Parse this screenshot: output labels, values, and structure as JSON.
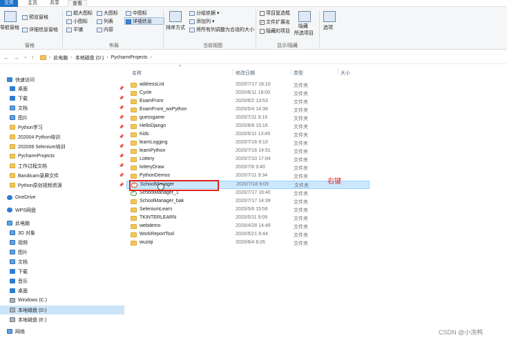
{
  "ribbon": {
    "tabs": [
      "文件",
      "主页",
      "共享",
      "查看"
    ],
    "navpane": {
      "label": "导航窗格"
    },
    "panes": {
      "preview": "预览窗格",
      "details": "详细信息窗格",
      "group": "窗格"
    },
    "layout": {
      "items": [
        "超大图标",
        "大图标",
        "中图标",
        "小图标",
        "列表",
        "详细信息",
        "平铺",
        "内容"
      ],
      "group": "布局"
    },
    "currentview": {
      "sort": "排序方式",
      "group_by": "分组依据",
      "add_columns": "添加列",
      "size_all": "将所有列调整为合适的大小",
      "group": "当前视图"
    },
    "showhide": {
      "item_checkboxes": "项目复选框",
      "file_extensions": "文件扩展名",
      "hidden_items": "隐藏的项目",
      "hide_selected": "隐藏",
      "hide_selected_2": "所选项目",
      "group": "显示/隐藏"
    },
    "options": "选项"
  },
  "address": {
    "crumbs": [
      "此电脑",
      "本地磁盘 (D:)",
      "PycharmProjects"
    ]
  },
  "sidebar": {
    "items": [
      {
        "label": "快速访问",
        "icon": "star-icon"
      },
      {
        "label": "桌面",
        "icon": "desktop-icon",
        "pinned": true
      },
      {
        "label": "下载",
        "icon": "download-icon",
        "pinned": true
      },
      {
        "label": "文档",
        "icon": "documents-icon",
        "pinned": true
      },
      {
        "label": "图片",
        "icon": "pictures-icon",
        "pinned": true
      },
      {
        "label": "Python学习",
        "icon": "folder-icon",
        "pinned": true
      },
      {
        "label": "202004 Python培训",
        "icon": "folder-icon",
        "pinned": true
      },
      {
        "label": "202006 Selenium培训",
        "icon": "folder-icon",
        "pinned": true
      },
      {
        "label": "PycharmProjects",
        "icon": "folder-icon",
        "pinned": true
      },
      {
        "label": "工作过程文档",
        "icon": "folder-icon",
        "pinned": true
      },
      {
        "label": "Bandicam录屏文件",
        "icon": "folder-icon",
        "pinned": true
      },
      {
        "label": "Python原创视频资源",
        "icon": "folder-icon",
        "pinned": true
      },
      {
        "label": "OneDrive",
        "icon": "onedrive-icon"
      },
      {
        "label": "WPS网盘",
        "icon": "wps-cloud-icon"
      },
      {
        "label": "此电脑",
        "icon": "this-pc-icon"
      },
      {
        "label": "3D 对象",
        "icon": "3d-objects-icon"
      },
      {
        "label": "视频",
        "icon": "videos-icon"
      },
      {
        "label": "图片",
        "icon": "pictures-icon"
      },
      {
        "label": "文档",
        "icon": "documents-icon"
      },
      {
        "label": "下载",
        "icon": "download-icon"
      },
      {
        "label": "音乐",
        "icon": "music-icon"
      },
      {
        "label": "桌面",
        "icon": "desktop-icon"
      },
      {
        "label": "Windows (C:)",
        "icon": "drive-icon"
      },
      {
        "label": "本地磁盘 (D:)",
        "icon": "drive-icon",
        "selected": true
      },
      {
        "label": "本地磁盘 (E:)",
        "icon": "drive-icon"
      },
      {
        "label": "网络",
        "icon": "network-icon"
      }
    ]
  },
  "list": {
    "columns": [
      "名称",
      "修改日期",
      "类型",
      "大小"
    ],
    "rows": [
      {
        "name": "addressList",
        "date": "2020/7/17 18:10",
        "type": "文件夹"
      },
      {
        "name": "Cycle",
        "date": "2020/6/11 18:00",
        "type": "文件夹"
      },
      {
        "name": "ExamFront",
        "date": "2020/6/2 13:53",
        "type": "文件夹"
      },
      {
        "name": "ExamFront_wxPython",
        "date": "2020/5/4 14:38",
        "type": "文件夹"
      },
      {
        "name": "guessgame",
        "date": "2020/7/11 9:16",
        "type": "文件夹"
      },
      {
        "name": "HelloDjango",
        "date": "2020/6/8 15:16",
        "type": "文件夹"
      },
      {
        "name": "Kids",
        "date": "2020/6/11 13:45",
        "type": "文件夹"
      },
      {
        "name": "learnLogging",
        "date": "2020/7/16 9:10",
        "type": "文件夹"
      },
      {
        "name": "learnPython",
        "date": "2020/7/16 14:51",
        "type": "文件夹"
      },
      {
        "name": "Lottery",
        "date": "2020/7/10 17:04",
        "type": "文件夹"
      },
      {
        "name": "lotteryDraw",
        "date": "2020/7/6 9:40",
        "type": "文件夹"
      },
      {
        "name": "PythonDemos",
        "date": "2020/7/11 9:34",
        "type": "文件夹"
      },
      {
        "name": "SchoolManager",
        "date": "2020/7/18 9:09",
        "type": "文件夹",
        "selected": true,
        "overlay": "error"
      },
      {
        "name": "SchoolManager_1",
        "date": "2020/7/17 16:40",
        "type": "文件夹",
        "overlay": "ok"
      },
      {
        "name": "SchoolManager_bak",
        "date": "2020/7/17 14:39",
        "type": "文件夹"
      },
      {
        "name": "SeleniumLearn",
        "date": "2020/5/6 15:56",
        "type": "文件夹"
      },
      {
        "name": "TKINTERLEARN",
        "date": "2020/5/11 9:09",
        "type": "文件夹"
      },
      {
        "name": "webdemo",
        "date": "2020/4/28 14:49",
        "type": "文件夹"
      },
      {
        "name": "WorkReportTool",
        "date": "2020/5/21 8:44",
        "type": "文件夹"
      },
      {
        "name": "wuziqi",
        "date": "2020/6/4 8:26",
        "type": "文件夹"
      }
    ]
  },
  "annotation": "右键",
  "watermark": "CSDN @小洗鸭"
}
